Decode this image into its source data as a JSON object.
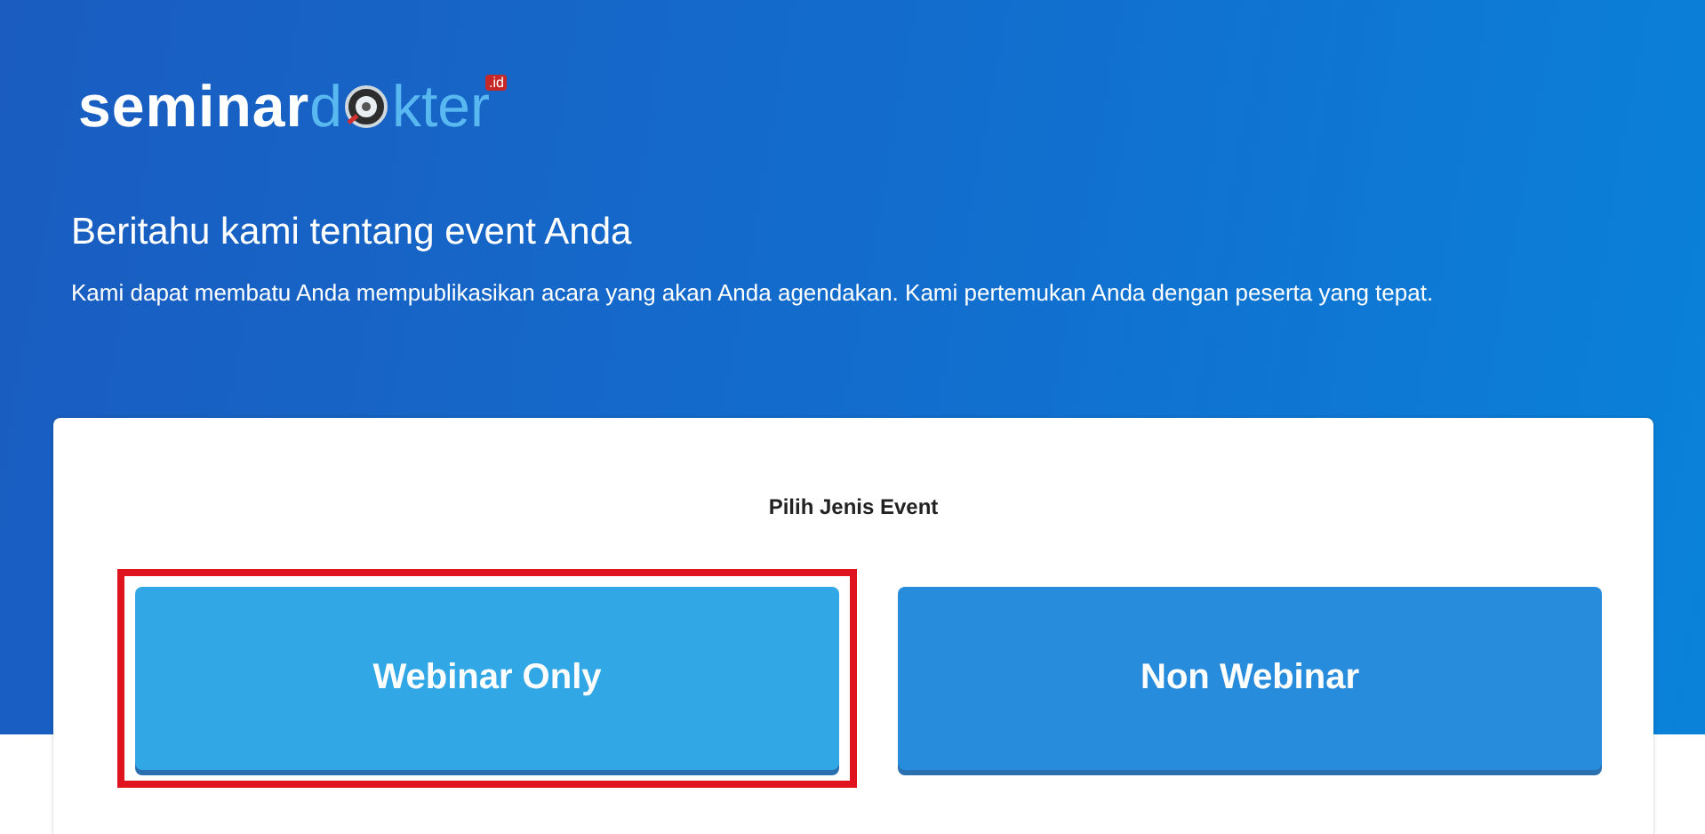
{
  "logo": {
    "part_1": "seminar",
    "part_2": "d",
    "part_3": "kter",
    "badge": ".id"
  },
  "heading": "Beritahu kami tentang event Anda",
  "subheading": "Kami dapat membatu Anda mempublikasikan acara yang akan Anda agendakan. Kami pertemukan Anda dengan peserta yang tepat.",
  "card": {
    "title": "Pilih Jenis Event",
    "options": [
      {
        "label": "Webinar Only",
        "selected": true
      },
      {
        "label": "Non Webinar",
        "selected": false
      }
    ]
  }
}
